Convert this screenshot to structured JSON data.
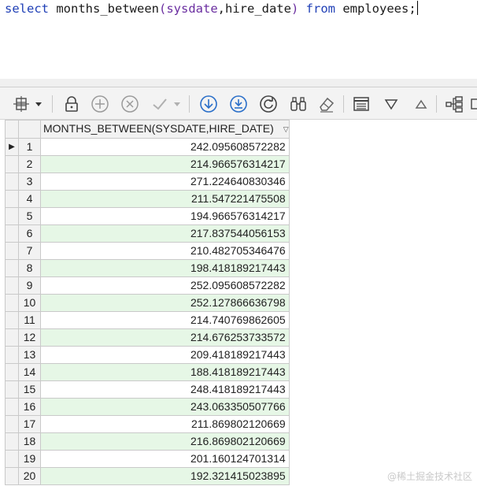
{
  "editor": {
    "tokens": [
      {
        "text": "select",
        "cls": "kw"
      },
      {
        "text": " months_between",
        "cls": ""
      },
      {
        "text": "(",
        "cls": "pn"
      },
      {
        "text": "sysdate",
        "cls": "pn"
      },
      {
        "text": ",hire_date",
        "cls": ""
      },
      {
        "text": ")",
        "cls": "pn"
      },
      {
        "text": " ",
        "cls": ""
      },
      {
        "text": "from",
        "cls": "kw"
      },
      {
        "text": " employees;",
        "cls": ""
      }
    ]
  },
  "toolbar": {
    "icons": [
      "grid-layout-icon",
      "dropdown-arrow-icon",
      "lock-icon",
      "add-row-icon",
      "delete-row-icon",
      "commit-check-icon",
      "commit-dropdown-icon",
      "fetch-next-icon",
      "fetch-all-icon",
      "refresh-icon",
      "find-icon",
      "clear-icon",
      "single-record-icon",
      "filter-icon",
      "sort-icon",
      "query-builder-icon"
    ]
  },
  "grid": {
    "column_header": "MONTHS_BETWEEN(SYSDATE,HIRE_DATE)",
    "sort_indicator": "▽",
    "row_pointer": "▶",
    "rows": [
      {
        "num": "1",
        "value": "242.095608572282"
      },
      {
        "num": "2",
        "value": "214.966576314217"
      },
      {
        "num": "3",
        "value": "271.224640830346"
      },
      {
        "num": "4",
        "value": "211.547221475508"
      },
      {
        "num": "5",
        "value": "194.966576314217"
      },
      {
        "num": "6",
        "value": "217.837544056153"
      },
      {
        "num": "7",
        "value": "210.482705346476"
      },
      {
        "num": "8",
        "value": "198.418189217443"
      },
      {
        "num": "9",
        "value": "252.095608572282"
      },
      {
        "num": "10",
        "value": "252.127866636798"
      },
      {
        "num": "11",
        "value": "214.740769862605"
      },
      {
        "num": "12",
        "value": "214.676253733572"
      },
      {
        "num": "13",
        "value": "209.418189217443"
      },
      {
        "num": "14",
        "value": "188.418189217443"
      },
      {
        "num": "15",
        "value": "248.418189217443"
      },
      {
        "num": "16",
        "value": "243.063350507766"
      },
      {
        "num": "17",
        "value": "211.869802120669"
      },
      {
        "num": "18",
        "value": "216.869802120669"
      },
      {
        "num": "19",
        "value": "201.160124701314"
      },
      {
        "num": "20",
        "value": "192.321415023895"
      }
    ]
  },
  "watermark": "@稀土掘金技术社区",
  "colors": {
    "keyword": "#1f3fb6",
    "paren": "#6a2ea0",
    "alt_row": "#e6f7e6",
    "icon_blue": "#2a6fc9"
  }
}
